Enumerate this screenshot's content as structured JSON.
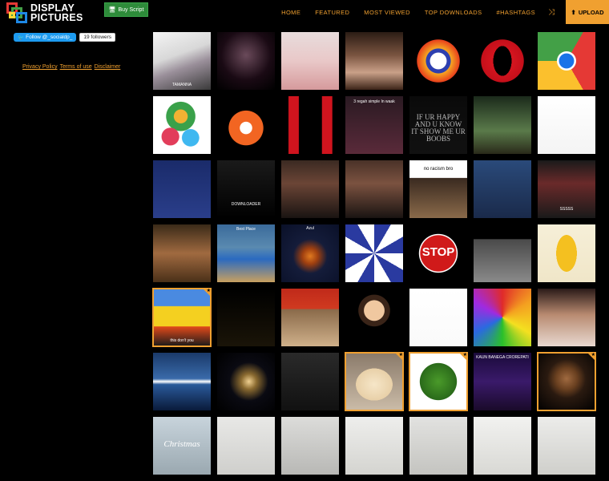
{
  "brand": {
    "line1": "DISPLAY",
    "line2": "PICTURES"
  },
  "header": {
    "buy_label": "Buy Script",
    "nav": [
      "HOME",
      "FEATURED",
      "MOST VIEWED",
      "TOP DOWNLOADS",
      "#HASHTAGS"
    ],
    "upload_label": "UPLOAD"
  },
  "sidebar": {
    "follow_label": "Follow @_socialdp_",
    "followers": "19 followers",
    "links": [
      "Privacy Policy",
      "Terms of use",
      "Disclaimer"
    ]
  },
  "tiles": [
    {
      "name": "tile-portrait-tamanna",
      "bg": "linear-gradient(160deg,#f4f4f4 0%,#d8d8d8 40%,#9a8f9a 60%,#3a3a3a 100%)",
      "text": "TAMANNA",
      "text_bottom": "3px",
      "featured": false
    },
    {
      "name": "tile-woman-dark",
      "bg": "radial-gradient(circle at 50% 40%,#6a4a5a 0%,#1a0a14 55%,#000 100%)",
      "text": "",
      "featured": false
    },
    {
      "name": "tile-blonde-woman",
      "bg": "linear-gradient(180deg,#e8dcdc 0%,#e9c8c8 50%,#d69a9c 100%)",
      "text": "",
      "featured": false
    },
    {
      "name": "tile-girl-portrait",
      "bg": "linear-gradient(180deg,#2b1c14 0%,#7a5440 40%,#c9a088 70%,#3c2418 100%)",
      "text": "",
      "featured": false
    },
    {
      "name": "tile-vpn-app-icon",
      "bg": "radial-gradient(circle at 50% 50%,#fff 0%,#fff 20%,#2d3fb0 21%,#2d3fb0 30%,#f5a623 31%,#e8401c 52%,#000 53%)",
      "text": "",
      "featured": false
    },
    {
      "name": "tile-opera-icon",
      "bg": "radial-gradient(ellipse 16% 26% at 50% 50%,#000 0%,#000 99%,transparent 100%),radial-gradient(circle at 50% 50%,#e41b24 0%,#c50f1a 52%,#000 53%)",
      "text": "",
      "featured": false
    },
    {
      "name": "tile-chrome-icon",
      "bg": "radial-gradient(circle at 50% 50%,#1a73e8 0%,#1a73e8 18%,#fff 19%,#fff 23%,transparent 24%),conic-gradient(from 30deg at 50% 50%,#e53935 0deg 120deg,#fbc02d 120deg 240deg,#43a047 240deg 360deg)",
      "mask": true,
      "text": "",
      "featured": false
    },
    {
      "name": "tile-easter-eggs",
      "bg": "radial-gradient(circle at 30% 70%,#e23d5a 0%,#e23d5a 15%,transparent 16%),radial-gradient(circle at 65% 72%,#3fb8f0 0%,#3fb8f0 15%,transparent 16%),radial-gradient(circle at 48% 35%,#f2b233 0%,#f2b233 14%,transparent 15%),radial-gradient(circle at 48% 35%,#3aa14a 0%,#3aa14a 30%,#fff 31%)",
      "text": "",
      "featured": false
    },
    {
      "name": "tile-avast-icon",
      "bg": "radial-gradient(circle at 50% 55%,#fff 0%,#fff 14%,#f26522 15%,#f26522 40%,#000 41%)",
      "text": "",
      "featured": false
    },
    {
      "name": "tile-red-bars",
      "bg": "linear-gradient(90deg,#000 0%,#000 12%,#d0141e 13%,#d0141e 30%,#000 31%,#000 70%,#d0141e 71%,#d0141e 88%,#000 89%)",
      "text": "",
      "featured": false
    },
    {
      "name": "tile-text-quote-pink",
      "bg": "linear-gradient(180deg,#2a1a22 0%,#5a2a3a 100%)",
      "text": "3 regah simple In waak",
      "text_top": "4px",
      "featured": false
    },
    {
      "name": "tile-text-happy",
      "bg": "linear-gradient(180deg,#0a0a0a 0%,#111 100%)",
      "text": "IF UR HAPPY AND U KNOW IT SHOW ME UR BOOBS",
      "text_top": "22px",
      "big": true,
      "featured": false
    },
    {
      "name": "tile-frog-bike",
      "bg": "linear-gradient(180deg,#1b2a1b 0%,#5a7a4a 60%,#2a2a1a 100%)",
      "text": "",
      "featured": false
    },
    {
      "name": "tile-sphynx-cat",
      "bg": "linear-gradient(180deg,#fff 0%,#f4f4f4 100%)",
      "text": "",
      "featured": false
    },
    {
      "name": "tile-dancing-earth",
      "bg": "linear-gradient(180deg,#1a2b6a 0%,#2a3e8a 100%)",
      "text": "",
      "featured": false
    },
    {
      "name": "tile-doodle-downloader",
      "bg": "linear-gradient(180deg,#1a1a1a 0%,#000 100%)",
      "text": "DOWNLOADER",
      "text_bottom": "14px",
      "featured": false
    },
    {
      "name": "tile-woman-saree-1",
      "bg": "linear-gradient(180deg,#3b2a22 0%,#6b4536 40%,#1a1412 100%)",
      "text": "",
      "featured": false
    },
    {
      "name": "tile-woman-saree-2",
      "bg": "linear-gradient(180deg,#4a3228 0%,#7b5240 40%,#1a1412 100%)",
      "text": "",
      "featured": false
    },
    {
      "name": "tile-gorillas",
      "bg": "linear-gradient(180deg,#fff 0%,#fff 30%,#3a2a20 31%,#8a6a4a 100%)",
      "text": "no racism bro",
      "text_top": "8px",
      "dark": true,
      "featured": false
    },
    {
      "name": "tile-penguins",
      "bg": "linear-gradient(180deg,#2a4a7a 0%,#1a2a4a 100%)",
      "text": "",
      "featured": false
    },
    {
      "name": "tile-red-eyes",
      "bg": "linear-gradient(180deg,#1a1a1a 0%,#6a2a2a 40%,#1a1a1a 100%)",
      "text": "SSSSS",
      "text_top": "58px",
      "featured": false
    },
    {
      "name": "tile-old-man",
      "bg": "linear-gradient(180deg,#3a2a18 0%,#a06a40 50%,#4a3018 100%)",
      "text": "",
      "featured": false
    },
    {
      "name": "tile-swimming-pool",
      "bg": "linear-gradient(180deg,#3a6a9a 0%,#5a8ab0 40%,#2a6ac0 60%,#c8a060 100%)",
      "text": "Best Place",
      "text_top": "3px",
      "featured": false
    },
    {
      "name": "tile-jellyfish",
      "bg": "radial-gradient(circle at 50% 55%,#e07a20 0%,#a04010 18%,#141c3a 40%,#0a1028 100%)",
      "text": "Azul",
      "text_top": "2px",
      "featured": false
    },
    {
      "name": "tile-meme-sunburst",
      "bg": "conic-gradient(from 0deg,#2a3aa0 0deg 30deg,#fff 30deg 60deg,#2a3aa0 60deg 90deg,#fff 90deg 120deg,#2a3aa0 120deg 150deg,#fff 150deg 180deg,#2a3aa0 180deg 210deg,#fff 210deg 240deg,#2a3aa0 240deg 270deg,#fff 270deg 300deg,#2a3aa0 300deg 330deg,#fff 330deg 360deg)",
      "text": "",
      "featured": false
    },
    {
      "name": "tile-stop-sign",
      "bg": "radial-gradient(circle at 50% 50%,#d01a1a 0%,#d01a1a 44%,#fff 45%,#fff 47%,#000 48%)",
      "text": "STOP",
      "text_top": "26px",
      "stop": true,
      "featured": false
    },
    {
      "name": "tile-cat-meme",
      "bg": "linear-gradient(180deg,#000 0%,#000 25%,#4a4a4a 26%,#8a8a8a 100%)",
      "text": "",
      "featured": false
    },
    {
      "name": "tile-banana",
      "bg": "radial-gradient(ellipse 18% 32% at 50% 50%,#f4c020 0%,#f4c020 99%,transparent 100%),linear-gradient(180deg,#f6efd8 0%,#f0e6c8 100%)",
      "text": "",
      "featured": false
    },
    {
      "name": "tile-simpsons",
      "bg": "linear-gradient(180deg,#4a8ae0 0%,#4a8ae0 30%,#f4d020 31%,#f4d020 65%,#e04a1a 66%,#1a1a1a 100%)",
      "text": "this don't you",
      "text_bottom": "4px",
      "featured": true
    },
    {
      "name": "tile-books-candle",
      "bg": "linear-gradient(180deg,#000 0%,#1a1408 100%)",
      "text": "",
      "featured": false
    },
    {
      "name": "tile-grumpy-cat",
      "bg": "linear-gradient(180deg,#c02a1a 0%,#d03a20 35%,#8a6a4a 36%,#cfb08a 100%)",
      "text": "",
      "featured": false
    },
    {
      "name": "tile-avatar-woman",
      "bg": "radial-gradient(circle at 50% 38%,#f0c8a0 0%,#f0c8a0 22%,#3a2418 23%,#3a2418 34%,#000 35%)",
      "text": "",
      "featured": false
    },
    {
      "name": "tile-emoji-diagram",
      "bg": "linear-gradient(180deg,#fff 0%,#fafafa 100%)",
      "text": "",
      "featured": false
    },
    {
      "name": "tile-rainbow-dog",
      "bg": "conic-gradient(from 0deg,#e02a2a,#f4a020,#f4e020,#2ac02a,#2a6ae0,#a02ae0,#e02a2a)",
      "text": "",
      "featured": false
    },
    {
      "name": "tile-girl-portrait-2",
      "bg": "linear-gradient(180deg,#2a1a18 0%,#b88a70 45%,#e8d8d0 100%)",
      "text": "",
      "featured": false
    },
    {
      "name": "tile-mountain-lake",
      "bg": "linear-gradient(180deg,#1a3a6a 0%,#3a6aaa 45%,#fff 50%,#2a5a9a 55%,#0a1a3a 100%)",
      "text": "",
      "featured": false
    },
    {
      "name": "tile-night-cloud",
      "bg": "radial-gradient(circle at 55% 50%,#f0d090 0%,#8a6a30 18%,#0a0a12 45%,#000 100%)",
      "text": "",
      "featured": false
    },
    {
      "name": "tile-dark-room",
      "bg": "linear-gradient(180deg,#2a2a2a 0%,#111 100%)",
      "text": "",
      "featured": false
    },
    {
      "name": "tile-drink-glass",
      "bg": "radial-gradient(ellipse 32% 28% at 50% 55%,#f6e6c8 0%,#e8d0a8 99%,transparent 100%),linear-gradient(180deg,#8a7a6a 0%,#cbbca8 100%)",
      "text": "",
      "featured": true
    },
    {
      "name": "tile-green-beans",
      "bg": "radial-gradient(circle at 50% 50%,#4a9a2a 0%,#2a6a1a 45%,#fff 46%)",
      "text": "",
      "featured": true
    },
    {
      "name": "tile-kbc-show",
      "bg": "linear-gradient(180deg,#1a0a3a 0%,#3a1a6a 50%,#1a0a2a 100%)",
      "text": "KAUN BANEGA CROREPATI",
      "text_top": "3px",
      "featured": false
    },
    {
      "name": "tile-man-beard",
      "bg": "radial-gradient(circle at 50% 45%,#a06a40 0%,#6a4020 25%,#2a1a10 45%,#000 100%)",
      "text": "",
      "featured": true
    },
    {
      "name": "tile-christmas",
      "bg": "linear-gradient(180deg,#c8d4dc 0%,#9aa8b0 100%)",
      "text": "Christmas",
      "text_top": "28px",
      "script": true,
      "featured": false
    },
    {
      "name": "tile-room-1",
      "bg": "linear-gradient(180deg,#e8e8e6 0%,#cfcfcc 100%)",
      "text": "",
      "featured": false
    },
    {
      "name": "tile-room-2",
      "bg": "linear-gradient(180deg,#dcdcda 0%,#b8b8b5 100%)",
      "text": "",
      "featured": false
    },
    {
      "name": "tile-room-3",
      "bg": "linear-gradient(180deg,#eeeeec 0%,#d4d4d0 100%)",
      "text": "",
      "featured": false
    },
    {
      "name": "tile-room-4",
      "bg": "linear-gradient(180deg,#e2e2e0 0%,#c4c4c0 100%)",
      "text": "",
      "featured": false
    },
    {
      "name": "tile-room-5",
      "bg": "linear-gradient(180deg,#f2f2f0 0%,#d8d8d4 100%)",
      "text": "",
      "featured": false
    },
    {
      "name": "tile-room-6",
      "bg": "linear-gradient(180deg,#ececea 0%,#cfcfcb 100%)",
      "text": "",
      "featured": false
    }
  ],
  "colors": {
    "accent": "#f0a030",
    "buy_green": "#2e8b3a",
    "twitter_blue": "#1d9bf0"
  }
}
